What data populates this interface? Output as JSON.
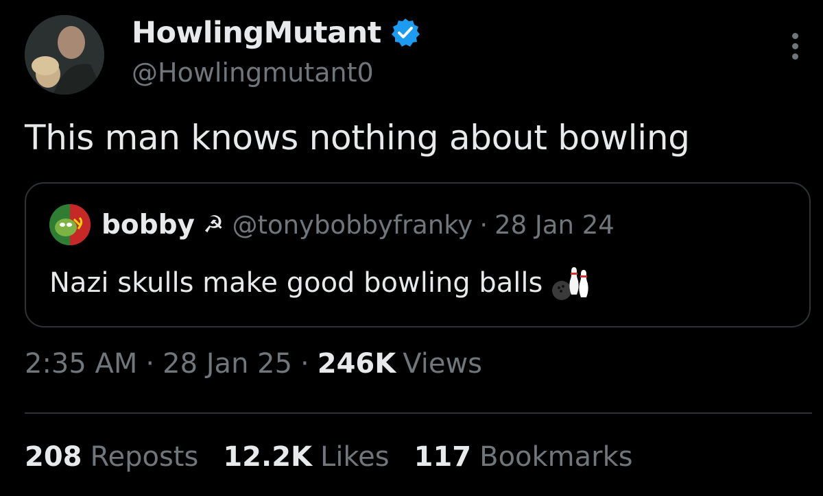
{
  "author": {
    "name": "HowlingMutant",
    "handle": "@Howlingmutant0",
    "verified": true
  },
  "tweet_text": "This man knows nothing about bowling",
  "quoted_tweet": {
    "author_name": "bobby",
    "name_emoji": "☭",
    "handle": "@tonybobbyfranky",
    "separator": "·",
    "date": "28 Jan 24",
    "text": "Nazi skulls make good bowling balls",
    "text_emoji_icon": "bowling-icon"
  },
  "meta": {
    "time": "2:35 AM",
    "separator": "·",
    "date": "28 Jan 25",
    "views_count": "246K",
    "views_label": "Views"
  },
  "stats": {
    "reposts_count": "208",
    "reposts_label": "Reposts",
    "likes_count": "12.2K",
    "likes_label": "Likes",
    "bookmarks_count": "117",
    "bookmarks_label": "Bookmarks"
  },
  "colors": {
    "background": "#000000",
    "text_primary": "#e7e9ea",
    "text_secondary": "#71767b",
    "verified_blue": "#1d9bf0",
    "border": "#2f3336"
  }
}
